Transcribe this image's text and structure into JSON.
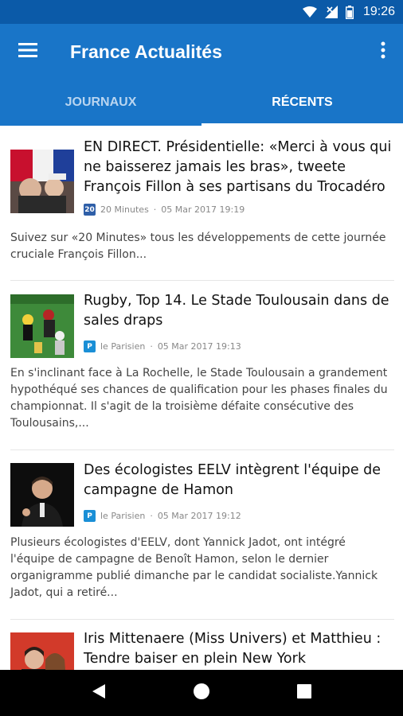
{
  "status_bar": {
    "time": "19:26"
  },
  "app_bar": {
    "title": "France Actualités"
  },
  "tabs": [
    {
      "label": "JOURNAUX",
      "active": false
    },
    {
      "label": "RÉCENTS",
      "active": true
    }
  ],
  "articles": [
    {
      "headline": "EN DIRECT. Présidentielle: «Merci à vous qui ne baisserez jamais les bras», tweete François Fillon à ses partisans du Trocadéro",
      "source": "20 Minutes",
      "date": "05 Mar 2017 19:19",
      "source_icon": "20min-icon",
      "excerpt": "Suivez sur «20 Minutes» tous les développements de cette journée cruciale François Fillon..."
    },
    {
      "headline": "Rugby, Top 14. Le Stade Toulousain dans de sales draps",
      "source": "le Parisien",
      "date": "05 Mar 2017 19:13",
      "source_icon": "parisien-icon",
      "excerpt": "En s'inclinant face à La Rochelle, le Stade Toulousain a grandement hypothéqué ses chances de qualification pour les phases finales du championnat. Il s'agit de la troisième défaite consécutive des Toulousains,..."
    },
    {
      "headline": "Des écologistes EELV intègrent l'équipe de campagne de Hamon",
      "source": "le Parisien",
      "date": "05 Mar 2017 19:12",
      "source_icon": "parisien-icon",
      "excerpt": "Plusieurs écologistes d'EELV, dont Yannick Jadot, ont intégré l'équipe de campagne de Benoît Hamon, selon le dernier organigramme publié dimanche par le candidat socialiste.Yannick Jadot, qui a retiré..."
    },
    {
      "headline": "Iris Mittenaere (Miss Univers) et Matthieu : Tendre baiser en plein New York",
      "source": "",
      "date": "",
      "source_icon": "",
      "excerpt": ""
    }
  ],
  "meta_separator": "·",
  "colors": {
    "status_bar": "#0b5aa8",
    "app_bar": "#1975c8",
    "tab_inactive": "#b9d5f0",
    "tab_active": "#ffffff"
  }
}
